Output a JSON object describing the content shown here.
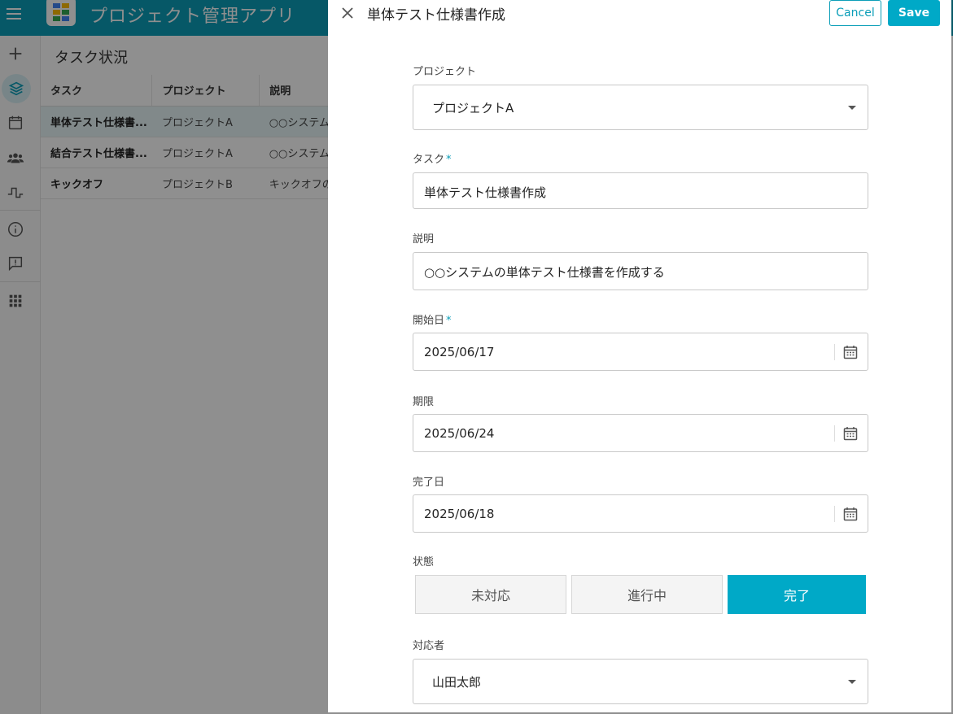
{
  "app": {
    "title": "プロジェクト管理アプリ",
    "accent_color": "#0b9eb8"
  },
  "sidebar": {
    "items": [
      {
        "icon": "plus-icon"
      },
      {
        "icon": "layers-icon",
        "active": true
      },
      {
        "icon": "calendar-icon"
      },
      {
        "icon": "users-icon"
      },
      {
        "icon": "pulse-icon"
      },
      {
        "icon": "info-icon"
      },
      {
        "icon": "feedback-icon"
      },
      {
        "icon": "apps-grid-icon"
      }
    ]
  },
  "main": {
    "page_title": "タスク状況",
    "table": {
      "columns": [
        "タスク",
        "プロジェクト",
        "説明"
      ],
      "rows": [
        {
          "task": "単体テスト仕様書...",
          "project": "プロジェクトA",
          "description": "○○システムの",
          "selected": true
        },
        {
          "task": "結合テスト仕様書...",
          "project": "プロジェクトA",
          "description": "○○システムの",
          "selected": false
        },
        {
          "task": "キックオフ",
          "project": "プロジェクトB",
          "description": "キックオフの",
          "selected": false
        }
      ]
    }
  },
  "dialog": {
    "title": "単体テスト仕様書作成",
    "cancel_label": "Cancel",
    "save_label": "Save",
    "fields": {
      "project": {
        "label": "プロジェクト",
        "value": "プロジェクトA"
      },
      "task": {
        "label": "タスク",
        "required_mark": "*",
        "value": "単体テスト仕様書作成"
      },
      "description": {
        "label": "説明",
        "value": "○○システムの単体テスト仕様書を作成する"
      },
      "start_date": {
        "label": "開始日",
        "required_mark": "*",
        "value": "2025/06/17"
      },
      "due_date": {
        "label": "期限",
        "value": "2025/06/24"
      },
      "done_date": {
        "label": "完了日",
        "value": "2025/06/18"
      },
      "status": {
        "label": "状態",
        "options": [
          "未対応",
          "進行中",
          "完了"
        ],
        "selected": "完了"
      },
      "assignee": {
        "label": "対応者",
        "value": "山田太郎"
      }
    }
  }
}
